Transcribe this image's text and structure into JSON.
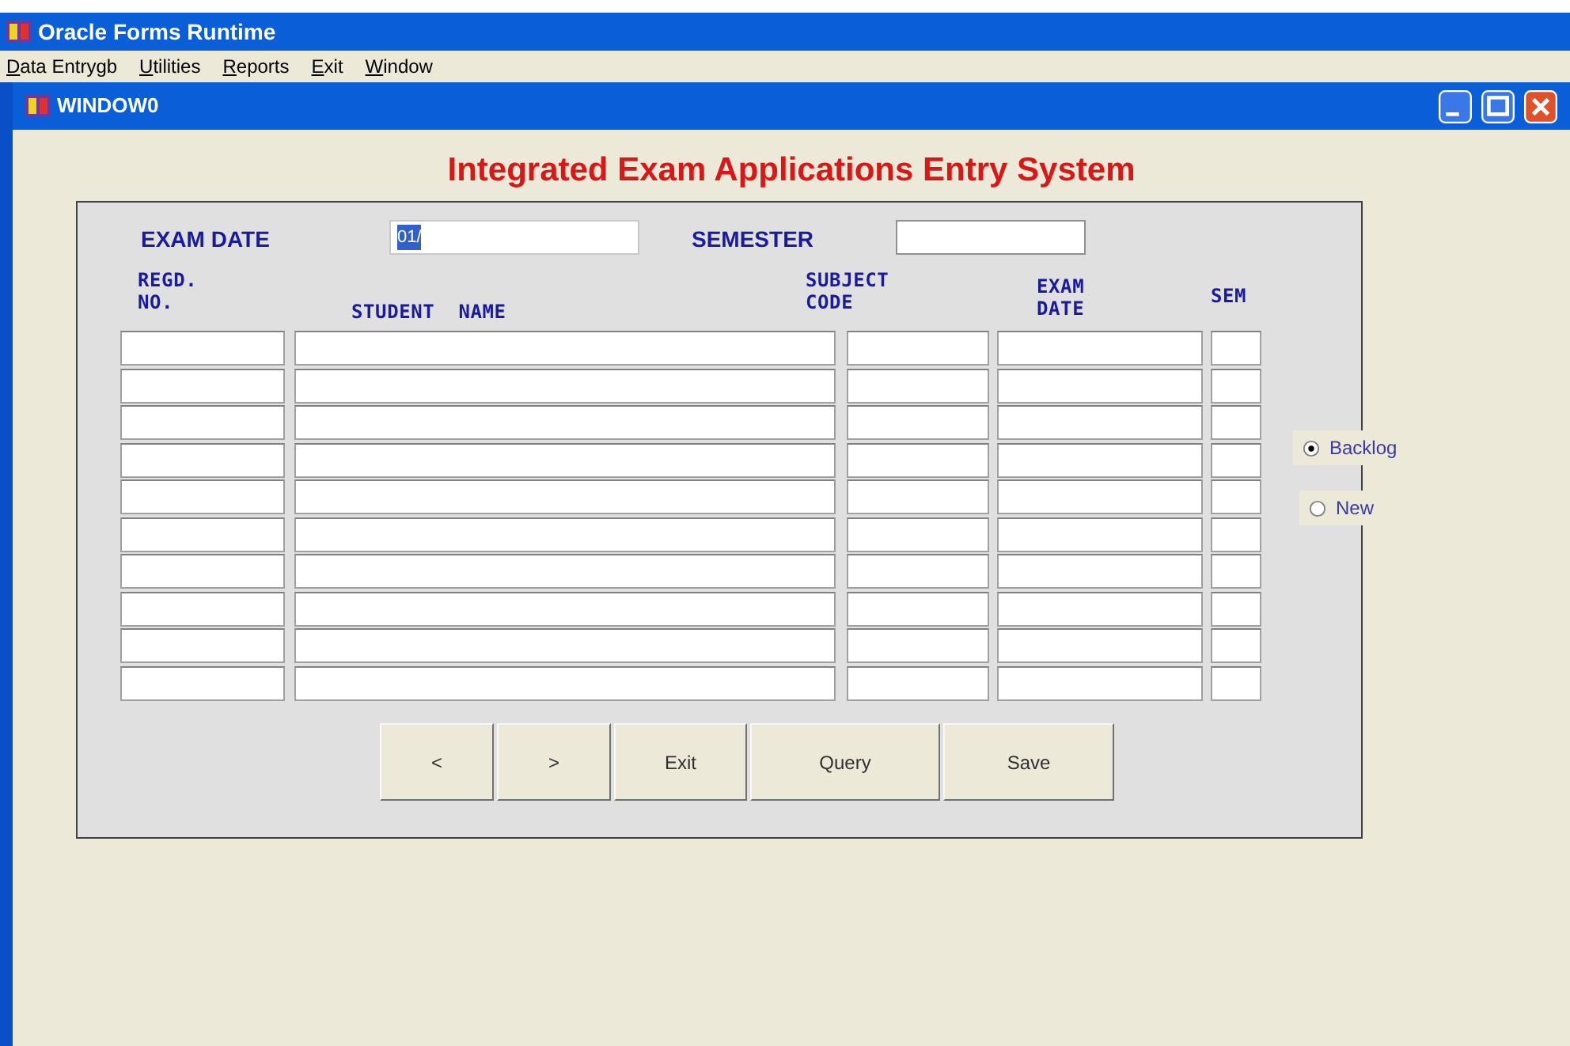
{
  "app_window": {
    "title": "Oracle Forms Runtime"
  },
  "menu": [
    {
      "accel": "D",
      "rest": "ata Entrygb"
    },
    {
      "accel": "U",
      "rest": "tilities"
    },
    {
      "accel": "R",
      "rest": "eports"
    },
    {
      "accel": "E",
      "rest": "xit"
    },
    {
      "accel": "W",
      "rest": "indow"
    }
  ],
  "inner_window": {
    "title": "WINDOW0"
  },
  "form": {
    "heading": "Integrated Exam Applications Entry System",
    "exam_date": {
      "label": "EXAM DATE",
      "value": "01/"
    },
    "semester": {
      "label": "SEMESTER"
    },
    "columns": [
      {
        "lines": [
          "REGD.",
          "NO."
        ]
      },
      {
        "lines": [
          "STUDENT  NAME"
        ]
      },
      {
        "lines": [
          "SUBJECT",
          "CODE"
        ]
      },
      {
        "lines": [
          "EXAM",
          "DATE"
        ]
      },
      {
        "lines": [
          "SEM"
        ]
      }
    ],
    "options": [
      {
        "label": "Backlog",
        "selected": true
      },
      {
        "label": "New",
        "selected": false
      }
    ],
    "buttons": [
      "<",
      ">",
      "Exit",
      "Query",
      "Save"
    ]
  }
}
